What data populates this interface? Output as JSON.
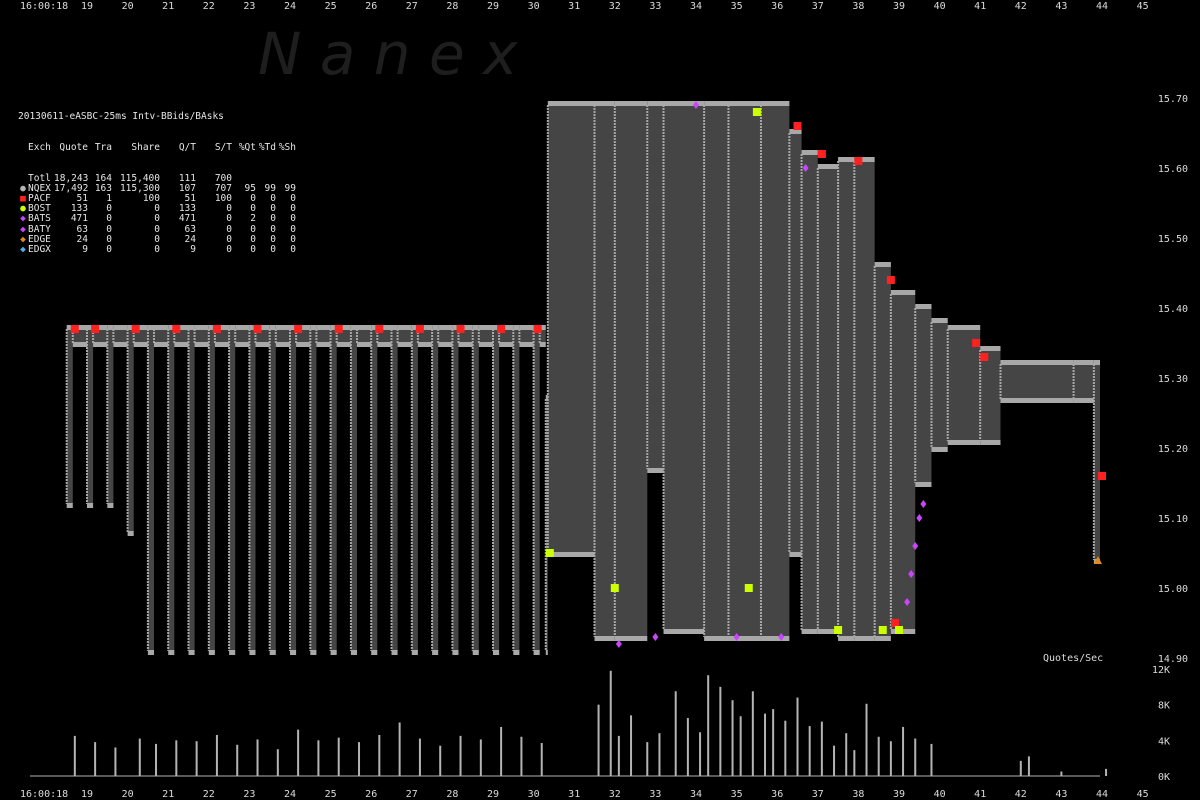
{
  "watermark": "N a n e x",
  "time_start_label": "16:00:18",
  "time_ticks": [
    "19",
    "20",
    "21",
    "22",
    "23",
    "24",
    "25",
    "26",
    "27",
    "28",
    "29",
    "30",
    "31",
    "32",
    "33",
    "34",
    "35",
    "36",
    "37",
    "38",
    "39",
    "40",
    "41",
    "42",
    "43",
    "44",
    "45"
  ],
  "price_labels": [
    "15.70",
    "15.60",
    "15.50",
    "15.40",
    "15.30",
    "15.20",
    "15.10",
    "15.00",
    "14.90"
  ],
  "volume_title": "Quotes/Sec",
  "volume_labels": [
    "12K",
    "8K",
    "4K",
    "0K"
  ],
  "legend": {
    "title": "20130611-eASBC-25ms Intv-BBids/BAsks",
    "columns": [
      "Exch",
      "Quote",
      "Tra",
      "Share",
      "Q/T",
      "S/T",
      "%Qt",
      "%Td",
      "%Sh"
    ],
    "rows": [
      {
        "exch": "Totl",
        "quote": "18,243",
        "tra": "164",
        "share": "115,400",
        "qt": "111",
        "st": "700",
        "pqt": "",
        "ptd": "",
        "psh": "",
        "symbol": "",
        "color": ""
      },
      {
        "exch": "NQEX",
        "quote": "17,492",
        "tra": "163",
        "share": "115,300",
        "qt": "107",
        "st": "707",
        "pqt": "95",
        "ptd": "99",
        "psh": "99",
        "symbol": "●",
        "color": "#b4b4b4"
      },
      {
        "exch": "PACF",
        "quote": "51",
        "tra": "1",
        "share": "100",
        "qt": "51",
        "st": "100",
        "pqt": "0",
        "ptd": "0",
        "psh": "0",
        "symbol": "■",
        "color": "#ff2020"
      },
      {
        "exch": "BOST",
        "quote": "133",
        "tra": "0",
        "share": "0",
        "qt": "133",
        "st": "0",
        "pqt": "0",
        "ptd": "0",
        "psh": "0",
        "symbol": "●",
        "color": "#ccff00"
      },
      {
        "exch": "BATS",
        "quote": "471",
        "tra": "0",
        "share": "0",
        "qt": "471",
        "st": "0",
        "pqt": "2",
        "ptd": "0",
        "psh": "0",
        "symbol": "◆",
        "color": "#cc44ff"
      },
      {
        "exch": "BATY",
        "quote": "63",
        "tra": "0",
        "share": "0",
        "qt": "63",
        "st": "0",
        "pqt": "0",
        "ptd": "0",
        "psh": "0",
        "symbol": "◆",
        "color": "#cc44ff"
      },
      {
        "exch": "EDGE",
        "quote": "24",
        "tra": "0",
        "share": "0",
        "qt": "24",
        "st": "0",
        "pqt": "0",
        "ptd": "0",
        "psh": "0",
        "symbol": "◆",
        "color": "#e08a1e"
      },
      {
        "exch": "EDGX",
        "quote": "9",
        "tra": "0",
        "share": "0",
        "qt": "9",
        "st": "0",
        "pqt": "0",
        "ptd": "0",
        "psh": "0",
        "symbol": "◆",
        "color": "#4ab0e8"
      }
    ]
  },
  "chart_data": [
    {
      "type": "area",
      "description_role": "price",
      "x_unit": "seconds past 16:00",
      "xlim": [
        18.5,
        45.3
      ],
      "ylim": [
        14.86,
        15.75
      ],
      "colors": {
        "spread": "#454545",
        "quote": "#a8a8a8",
        "pacf": "#ff2020",
        "bost": "#ccff00",
        "bats": "#cc44ff",
        "edge": "#e08a1e"
      },
      "spread_segments": [
        {
          "x0": 18.5,
          "x1": 18.65,
          "bid": 15.12,
          "ask": 15.37
        },
        {
          "x0": 18.65,
          "x1": 19.0,
          "bid": 15.35,
          "ask": 15.37
        },
        {
          "x0": 19.0,
          "x1": 19.15,
          "bid": 15.12,
          "ask": 15.37
        },
        {
          "x0": 19.15,
          "x1": 19.5,
          "bid": 15.35,
          "ask": 15.37
        },
        {
          "x0": 19.5,
          "x1": 19.65,
          "bid": 15.12,
          "ask": 15.37
        },
        {
          "x0": 19.65,
          "x1": 20.0,
          "bid": 15.35,
          "ask": 15.37
        },
        {
          "x0": 20.0,
          "x1": 20.15,
          "bid": 15.08,
          "ask": 15.37
        },
        {
          "x0": 20.15,
          "x1": 20.5,
          "bid": 15.35,
          "ask": 15.37
        },
        {
          "x0": 20.5,
          "x1": 20.65,
          "bid": 14.91,
          "ask": 15.37
        },
        {
          "x0": 20.65,
          "x1": 21.0,
          "bid": 15.35,
          "ask": 15.37
        },
        {
          "x0": 21.0,
          "x1": 21.15,
          "bid": 14.91,
          "ask": 15.37
        },
        {
          "x0": 21.15,
          "x1": 21.5,
          "bid": 15.35,
          "ask": 15.37
        },
        {
          "x0": 21.5,
          "x1": 21.65,
          "bid": 14.91,
          "ask": 15.37
        },
        {
          "x0": 21.65,
          "x1": 22.0,
          "bid": 15.35,
          "ask": 15.37
        },
        {
          "x0": 22.0,
          "x1": 22.15,
          "bid": 14.91,
          "ask": 15.37
        },
        {
          "x0": 22.15,
          "x1": 22.5,
          "bid": 15.35,
          "ask": 15.37
        },
        {
          "x0": 22.5,
          "x1": 22.65,
          "bid": 14.91,
          "ask": 15.37
        },
        {
          "x0": 22.65,
          "x1": 23.0,
          "bid": 15.35,
          "ask": 15.37
        },
        {
          "x0": 23.0,
          "x1": 23.15,
          "bid": 14.91,
          "ask": 15.37
        },
        {
          "x0": 23.15,
          "x1": 23.5,
          "bid": 15.35,
          "ask": 15.37
        },
        {
          "x0": 23.5,
          "x1": 23.65,
          "bid": 14.91,
          "ask": 15.37
        },
        {
          "x0": 23.65,
          "x1": 24.0,
          "bid": 15.35,
          "ask": 15.37
        },
        {
          "x0": 24.0,
          "x1": 24.15,
          "bid": 14.91,
          "ask": 15.37
        },
        {
          "x0": 24.15,
          "x1": 24.5,
          "bid": 15.35,
          "ask": 15.37
        },
        {
          "x0": 24.5,
          "x1": 24.65,
          "bid": 14.91,
          "ask": 15.37
        },
        {
          "x0": 24.65,
          "x1": 25.0,
          "bid": 15.35,
          "ask": 15.37
        },
        {
          "x0": 25.0,
          "x1": 25.15,
          "bid": 14.91,
          "ask": 15.37
        },
        {
          "x0": 25.15,
          "x1": 25.5,
          "bid": 15.35,
          "ask": 15.37
        },
        {
          "x0": 25.5,
          "x1": 25.65,
          "bid": 14.91,
          "ask": 15.37
        },
        {
          "x0": 25.65,
          "x1": 26.0,
          "bid": 15.35,
          "ask": 15.37
        },
        {
          "x0": 26.0,
          "x1": 26.15,
          "bid": 14.91,
          "ask": 15.37
        },
        {
          "x0": 26.15,
          "x1": 26.5,
          "bid": 15.35,
          "ask": 15.37
        },
        {
          "x0": 26.5,
          "x1": 26.65,
          "bid": 14.91,
          "ask": 15.37
        },
        {
          "x0": 26.65,
          "x1": 27.0,
          "bid": 15.35,
          "ask": 15.37
        },
        {
          "x0": 27.0,
          "x1": 27.15,
          "bid": 14.91,
          "ask": 15.37
        },
        {
          "x0": 27.15,
          "x1": 27.5,
          "bid": 15.35,
          "ask": 15.37
        },
        {
          "x0": 27.5,
          "x1": 27.65,
          "bid": 14.91,
          "ask": 15.37
        },
        {
          "x0": 27.65,
          "x1": 28.0,
          "bid": 15.35,
          "ask": 15.37
        },
        {
          "x0": 28.0,
          "x1": 28.15,
          "bid": 14.91,
          "ask": 15.37
        },
        {
          "x0": 28.15,
          "x1": 28.5,
          "bid": 15.35,
          "ask": 15.37
        },
        {
          "x0": 28.5,
          "x1": 28.65,
          "bid": 14.91,
          "ask": 15.37
        },
        {
          "x0": 28.65,
          "x1": 29.0,
          "bid": 15.35,
          "ask": 15.37
        },
        {
          "x0": 29.0,
          "x1": 29.15,
          "bid": 14.91,
          "ask": 15.37
        },
        {
          "x0": 29.15,
          "x1": 29.5,
          "bid": 15.35,
          "ask": 15.37
        },
        {
          "x0": 29.5,
          "x1": 29.65,
          "bid": 14.91,
          "ask": 15.37
        },
        {
          "x0": 29.65,
          "x1": 30.0,
          "bid": 15.35,
          "ask": 15.37
        },
        {
          "x0": 30.0,
          "x1": 30.15,
          "bid": 14.91,
          "ask": 15.37
        },
        {
          "x0": 30.15,
          "x1": 30.3,
          "bid": 15.35,
          "ask": 15.37
        },
        {
          "x0": 30.3,
          "x1": 30.35,
          "bid": 14.91,
          "ask": 15.27
        },
        {
          "x0": 30.35,
          "x1": 31.5,
          "bid": 15.05,
          "ask": 15.69
        },
        {
          "x0": 31.5,
          "x1": 32.0,
          "bid": 14.93,
          "ask": 15.69
        },
        {
          "x0": 32.0,
          "x1": 32.8,
          "bid": 14.93,
          "ask": 15.69
        },
        {
          "x0": 32.8,
          "x1": 33.2,
          "bid": 15.17,
          "ask": 15.69
        },
        {
          "x0": 33.2,
          "x1": 34.2,
          "bid": 14.94,
          "ask": 15.69
        },
        {
          "x0": 34.2,
          "x1": 34.8,
          "bid": 14.93,
          "ask": 15.69
        },
        {
          "x0": 34.8,
          "x1": 35.6,
          "bid": 14.93,
          "ask": 15.69
        },
        {
          "x0": 35.6,
          "x1": 36.3,
          "bid": 14.93,
          "ask": 15.69
        },
        {
          "x0": 36.3,
          "x1": 36.6,
          "bid": 15.05,
          "ask": 15.65
        },
        {
          "x0": 36.6,
          "x1": 37.0,
          "bid": 14.94,
          "ask": 15.62
        },
        {
          "x0": 37.0,
          "x1": 37.5,
          "bid": 14.94,
          "ask": 15.6
        },
        {
          "x0": 37.5,
          "x1": 37.9,
          "bid": 14.93,
          "ask": 15.61
        },
        {
          "x0": 37.9,
          "x1": 38.4,
          "bid": 14.93,
          "ask": 15.61
        },
        {
          "x0": 38.4,
          "x1": 38.8,
          "bid": 14.93,
          "ask": 15.46
        },
        {
          "x0": 38.8,
          "x1": 39.4,
          "bid": 14.94,
          "ask": 15.42
        },
        {
          "x0": 39.4,
          "x1": 39.8,
          "bid": 15.15,
          "ask": 15.4
        },
        {
          "x0": 39.8,
          "x1": 40.2,
          "bid": 15.2,
          "ask": 15.38
        },
        {
          "x0": 40.2,
          "x1": 41.0,
          "bid": 15.21,
          "ask": 15.37
        },
        {
          "x0": 41.0,
          "x1": 41.5,
          "bid": 15.21,
          "ask": 15.34
        },
        {
          "x0": 41.5,
          "x1": 43.3,
          "bid": 15.27,
          "ask": 15.32
        },
        {
          "x0": 43.3,
          "x1": 43.8,
          "bid": 15.27,
          "ask": 15.32
        },
        {
          "x0": 43.8,
          "x1": 44.1,
          "bid": 15.04,
          "ask": 15.32
        }
      ],
      "pacf_marks": [
        [
          18.7,
          15.37
        ],
        [
          19.2,
          15.37
        ],
        [
          20.2,
          15.37
        ],
        [
          21.2,
          15.37
        ],
        [
          22.2,
          15.37
        ],
        [
          23.2,
          15.37
        ],
        [
          24.2,
          15.37
        ],
        [
          25.2,
          15.37
        ],
        [
          26.2,
          15.37
        ],
        [
          27.2,
          15.37
        ],
        [
          28.2,
          15.37
        ],
        [
          29.2,
          15.37
        ],
        [
          30.1,
          15.37
        ],
        [
          36.5,
          15.66
        ],
        [
          37.1,
          15.62
        ],
        [
          38.0,
          15.61
        ],
        [
          38.8,
          15.44
        ],
        [
          40.9,
          15.35
        ],
        [
          41.1,
          15.33
        ],
        [
          44.0,
          15.16
        ],
        [
          38.9,
          14.95
        ]
      ],
      "bost_marks": [
        [
          30.4,
          15.05
        ],
        [
          32.0,
          15.0
        ],
        [
          35.3,
          15.0
        ],
        [
          37.5,
          14.94
        ],
        [
          38.6,
          14.94
        ],
        [
          39.0,
          14.94
        ],
        [
          35.5,
          15.68
        ]
      ],
      "bats_marks": [
        [
          32.1,
          14.92
        ],
        [
          33.0,
          14.93
        ],
        [
          35.0,
          14.93
        ],
        [
          36.1,
          14.93
        ],
        [
          36.7,
          15.6
        ],
        [
          39.2,
          14.98
        ],
        [
          39.3,
          15.02
        ],
        [
          39.4,
          15.06
        ],
        [
          39.5,
          15.1
        ],
        [
          39.6,
          15.12
        ],
        [
          34.0,
          15.69
        ]
      ],
      "edge_marks": [
        [
          43.9,
          15.04
        ]
      ]
    },
    {
      "type": "bar",
      "description_role": "volume",
      "title": "Quotes/Sec",
      "x_unit": "seconds past 16:00",
      "ylim": [
        0,
        12000
      ],
      "x": [
        18.7,
        19.2,
        19.7,
        20.3,
        20.7,
        21.2,
        21.7,
        22.2,
        22.7,
        23.2,
        23.7,
        24.2,
        24.7,
        25.2,
        25.7,
        26.2,
        26.7,
        27.2,
        27.7,
        28.2,
        28.7,
        29.2,
        29.7,
        30.2,
        31.6,
        31.9,
        32.1,
        32.4,
        32.8,
        33.1,
        33.5,
        33.8,
        34.1,
        34.3,
        34.6,
        34.9,
        35.1,
        35.4,
        35.7,
        35.9,
        36.2,
        36.5,
        36.8,
        37.1,
        37.4,
        37.7,
        37.9,
        38.2,
        38.5,
        38.8,
        39.1,
        39.4,
        39.8,
        42.0,
        42.2,
        43.0,
        44.1
      ],
      "values": [
        4500,
        3800,
        3200,
        4200,
        3600,
        4000,
        3900,
        4600,
        3500,
        4100,
        3000,
        5200,
        4000,
        4300,
        3800,
        4600,
        6000,
        4200,
        3400,
        4500,
        4100,
        5500,
        4400,
        3700,
        8000,
        11800,
        4500,
        6800,
        3800,
        4800,
        9500,
        6500,
        4900,
        11300,
        10000,
        8500,
        6700,
        9500,
        7000,
        7500,
        6200,
        8800,
        5600,
        6100,
        3400,
        4800,
        2900,
        8100,
        4400,
        3900,
        5500,
        4200,
        3600,
        1700,
        2200,
        500,
        800
      ],
      "series_color": "#b4b4b4"
    }
  ]
}
